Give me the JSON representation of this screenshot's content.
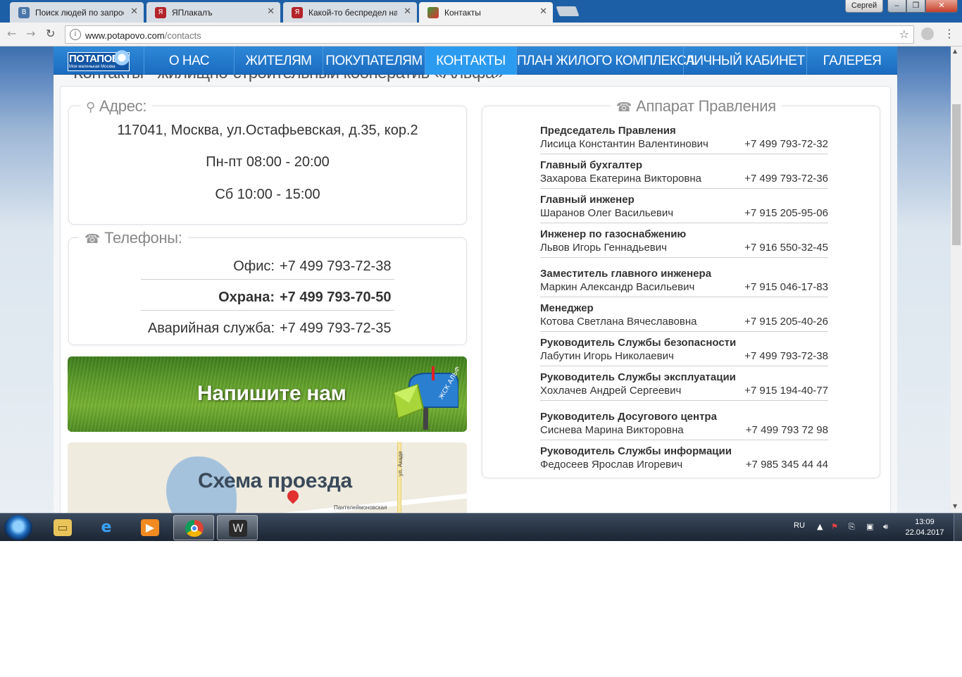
{
  "browser": {
    "tabs": [
      {
        "title": "Поиск людей по запрос",
        "favicon": "vk-icon",
        "active": false
      },
      {
        "title": "ЯПлакалъ",
        "favicon": "yaplakal-icon",
        "active": false
      },
      {
        "title": "Какой-то беспредел на",
        "favicon": "yaplakal-icon",
        "active": false
      },
      {
        "title": "Контакты",
        "favicon": "site-icon",
        "active": true
      }
    ],
    "profile_name": "Сергей",
    "url_host": "www.potapovo.com",
    "url_path": "/contacts"
  },
  "site": {
    "logo_text": "ПОТАПОВО",
    "logo_subtitle": "Моя маленькая Москва",
    "nav": [
      {
        "label": "О НАС",
        "active": false
      },
      {
        "label": "ЖИТЕЛЯМ",
        "active": false
      },
      {
        "label": "ПОКУПАТЕЛЯМ",
        "active": false
      },
      {
        "label": "КОНТАКТЫ",
        "active": true
      },
      {
        "label": "ПЛАН ЖИЛОГО КОМПЛЕКСА",
        "active": false
      },
      {
        "label": "ЛИЧНЫЙ КАБИНЕТ",
        "active": false
      },
      {
        "label": "ГАЛЕРЕЯ",
        "active": false
      }
    ],
    "accent_color": "#1f76c9"
  },
  "page": {
    "heading": "Контакты - жилищно-строительный кооператив «Альфа»",
    "address": {
      "legend": "Адрес:",
      "street": "117041, Москва, ул.Остафьевская, д.35, кор.2",
      "weekday_hours": "Пн-пт 08:00 - 20:00",
      "saturday_hours": "Сб 10:00 - 15:00"
    },
    "phones": {
      "legend": "Телефоны:",
      "rows": [
        {
          "label": "Офис:",
          "number": "+7 499 793-72-38"
        },
        {
          "label": "Охрана:",
          "number": "+7 499 793-70-50"
        },
        {
          "label": "Аварийная служба:",
          "number": "+7 499 793-72-35"
        }
      ]
    },
    "write_banner": {
      "text": "Напишите нам",
      "mailbox_label": "ЖСК АЛЬФА"
    },
    "map": {
      "title": "Схема проезда",
      "street": "Пантелеймоновская",
      "street2": "ул. Акаде"
    },
    "board": {
      "legend": "Аппарат Правления",
      "staff": [
        {
          "role": "Председатель Правления",
          "name": "Лисица Константин Валентинович",
          "phone": "+7 499 793-72-32"
        },
        {
          "role": "Главный бухгалтер",
          "name": "Захарова Екатерина Викторовна",
          "phone": "+7 499 793-72-36"
        },
        {
          "role": "Главный инженер",
          "name": "Шаранов Олег Васильевич",
          "phone": "+7 915 205-95-06"
        },
        {
          "role": "Инженер по газоснабжению",
          "name": "Львов Игорь Геннадьевич",
          "phone": "+7 916 550-32-45"
        },
        {
          "role": "Заместитель главного инженера",
          "name": "Маркин Александр Васильевич",
          "phone": "+7 915 046-17-83"
        },
        {
          "role": "Менеджер",
          "name": "Котова Светлана Вячеславовна",
          "phone": "+7 915 205-40-26"
        },
        {
          "role": "Руководитель Службы безопасности",
          "name": "Лабутин Игорь Николаевич",
          "phone": "+7 499 793-72-38"
        },
        {
          "role": "Руководитель Службы эксплуатации",
          "name": "Хохлачев Андрей Сергеевич",
          "phone": "+7 915 194-40-77"
        },
        {
          "role": "Руководитель Досугового центра",
          "name": "Сиснева Марина Викторовна",
          "phone": "+7 499 793 72 98"
        },
        {
          "role": "Руководитель Службы информации",
          "name": "Федосеев Ярослав Игоревич",
          "phone": "+7 985 345 44 44"
        }
      ]
    }
  },
  "taskbar": {
    "language": "RU",
    "time": "13:09",
    "date": "22.04.2017"
  }
}
